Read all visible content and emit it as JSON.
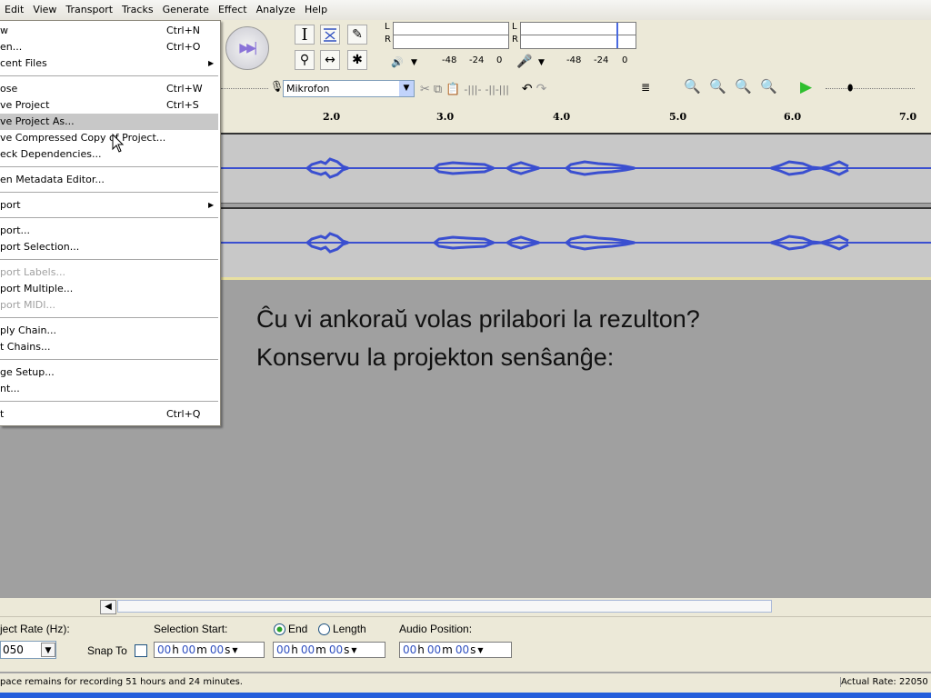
{
  "menubar": {
    "items": [
      "Edit",
      "View",
      "Transport",
      "Tracks",
      "Generate",
      "Effect",
      "Analyze",
      "Help"
    ]
  },
  "toolbar": {
    "meter_l": "L",
    "meter_r": "R",
    "meter_scale_play": [
      "-48",
      "-24",
      "0"
    ],
    "meter_scale_rec": [
      "-48",
      "-24",
      "0"
    ],
    "input_source": "Mikrofon"
  },
  "ruler": {
    "ticks": [
      "2.0",
      "3.0",
      "4.0",
      "5.0",
      "6.0",
      "7.0"
    ]
  },
  "file_menu": {
    "items": [
      {
        "label": "w",
        "shortcut": "Ctrl+N"
      },
      {
        "label": "en...",
        "shortcut": "Ctrl+O"
      },
      {
        "label": "cent Files",
        "submenu": "▶"
      },
      {
        "label": "ose",
        "shortcut": "Ctrl+W"
      },
      {
        "label": "ve Project",
        "shortcut": "Ctrl+S"
      },
      {
        "label": "ve Project As..."
      },
      {
        "label": "ve Compressed Copy of Project..."
      },
      {
        "label": "eck Dependencies..."
      },
      {
        "label": "en Metadata Editor..."
      },
      {
        "label": "port",
        "submenu": "▶"
      },
      {
        "label": "port..."
      },
      {
        "label": "port Selection..."
      },
      {
        "label": "port Labels..."
      },
      {
        "label": "port Multiple..."
      },
      {
        "label": "port MIDI..."
      },
      {
        "label": "ply Chain..."
      },
      {
        "label": "t Chains..."
      },
      {
        "label": "ge Setup..."
      },
      {
        "label": "nt..."
      },
      {
        "label": "t",
        "shortcut": "Ctrl+Q"
      }
    ]
  },
  "overlay": {
    "line1": "Ĉu vi ankoraŭ volas prilabori la rezulton?",
    "line2": "Konservu la projekton senŝanĝe:"
  },
  "selection": {
    "rate_label": "ject Rate (Hz):",
    "rate_value": "050",
    "snap_label": "Snap To",
    "start_label": "Selection Start:",
    "end_label": "End",
    "length_label": "Length",
    "audio_pos_label": "Audio Position:",
    "time_value": [
      "00",
      "h",
      "00",
      "m",
      "00",
      "s"
    ]
  },
  "status": {
    "left": "pace remains for recording 51 hours and 24 minutes.",
    "right": "Actual Rate: 22050"
  },
  "colors": {
    "wave": "#3a4fd0",
    "accent": "#3050c0",
    "play": "#2fbf2f"
  }
}
